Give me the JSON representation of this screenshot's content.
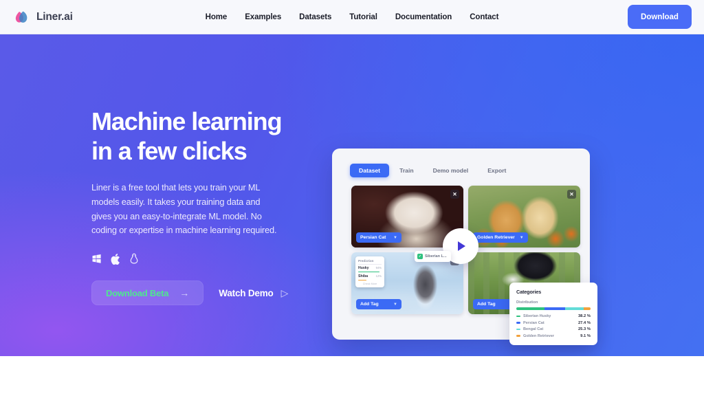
{
  "navbar": {
    "brand": "Liner.ai",
    "logo_icon": "droplet-logo-icon",
    "links": [
      {
        "label": "Home"
      },
      {
        "label": "Examples"
      },
      {
        "label": "Datasets"
      },
      {
        "label": "Tutorial"
      },
      {
        "label": "Documentation"
      },
      {
        "label": "Contact"
      }
    ],
    "download_label": "Download",
    "accent": "#4a6cf7",
    "background": "#f7f8fc"
  },
  "hero": {
    "headline_line1": "Machine learning",
    "headline_line2": "in a few clicks",
    "subcopy": "Liner is a free tool that lets you train your ML models easily. It takes your training data and gives you an easy-to-integrate ML model. No coding or expertise in machine learning required.",
    "platforms": [
      {
        "name": "windows-icon",
        "label": "Windows"
      },
      {
        "name": "apple-icon",
        "label": "macOS"
      },
      {
        "name": "linux-icon",
        "label": "Linux"
      }
    ],
    "primary_cta": {
      "label": "Download Beta",
      "arrow": "→",
      "text_color": "#4ee88f"
    },
    "secondary_cta": {
      "label": "Watch Demo",
      "glyph": "▷"
    },
    "gradient_from": "#5a5ae8",
    "gradient_to": "#4470f2",
    "purple_accent": "#9656f0"
  },
  "mockup": {
    "tabs": [
      {
        "label": "Dataset",
        "active": true
      },
      {
        "label": "Train",
        "active": false
      },
      {
        "label": "Demo model",
        "active": false
      },
      {
        "label": "Export",
        "active": false
      }
    ],
    "active_tab_color": "#3b6af5",
    "cards": [
      {
        "photo": "white-kitten-photo",
        "tag": "Persian Cat",
        "has_close": true,
        "tag_style": "filled"
      },
      {
        "photo": "golden-retriever-puppies-photo",
        "tag": "Golden Retriever",
        "has_close": true,
        "tag_style": "filled"
      },
      {
        "photo": "siberian-husky-snow-photo",
        "tag": "Add Tag",
        "has_close": true,
        "tag_style": "filled"
      },
      {
        "photo": "black-puppy-grass-photo",
        "tag": "Add Tag",
        "has_close": false,
        "tag_style": "filled"
      }
    ],
    "prediction_popover": {
      "title": "Prediction",
      "rows": [
        {
          "name": "Husky",
          "pct": "94%",
          "bar_color": "#2fc17f",
          "bar_width": "92%"
        },
        {
          "name": "Shiba",
          "pct": "12%",
          "bar_color": "#f0a33a",
          "bar_width": "34%"
        }
      ],
      "more_label": "Check More"
    },
    "toast": {
      "icon": "tag-check-icon",
      "text": "Siberian L..."
    },
    "play_button": {
      "name": "play-demo-button",
      "glyph": "▶",
      "color": "#4338d6"
    }
  },
  "chart_data": {
    "type": "bar",
    "title": "Categories",
    "subtitle": "Distribution",
    "xlabel": "",
    "ylabel": "",
    "legend_position": "bottom",
    "grid": false,
    "categories": [
      "Siberian Husky",
      "Persian Cat",
      "Bengal Cat",
      "Golden Retriever"
    ],
    "values": [
      38.2,
      27.4,
      25.3,
      9.1
    ],
    "value_labels": [
      "38.2 %",
      "27.4 %",
      "25.3 %",
      "9.1 %"
    ],
    "colors": [
      "#2fc17f",
      "#3b6af5",
      "#63dcd8",
      "#f2a13c"
    ],
    "unit": "%"
  }
}
